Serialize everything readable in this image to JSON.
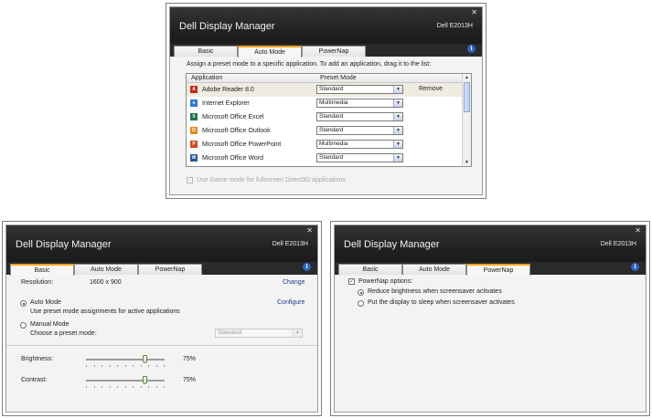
{
  "app_title": "Dell Display Manager",
  "model": "Dell E2013H",
  "close_glyph": "✕",
  "info_glyph": "i",
  "tabs": [
    "Basic",
    "Auto Mode",
    "PowerNap"
  ],
  "auto_mode": {
    "instruction": "Assign a preset mode to a specific application. To add an application, drag it to the list:",
    "col_application": "Application",
    "col_preset": "Preset Mode",
    "remove_label": "Remove",
    "rows": [
      {
        "app": "Adobe Reader 8.0",
        "mode": "Standard",
        "icon": "adobe-reader-icon",
        "color": "#c8281e",
        "glyph": "A"
      },
      {
        "app": "Internet Explorer",
        "mode": "Multimedia",
        "icon": "internet-explorer-icon",
        "color": "#2f7bd0",
        "glyph": "e"
      },
      {
        "app": "Microsoft Office Excel",
        "mode": "Standard",
        "icon": "excel-icon",
        "color": "#217346",
        "glyph": "X"
      },
      {
        "app": "Microsoft Office Outlook",
        "mode": "Standard",
        "icon": "outlook-icon",
        "color": "#e08a1e",
        "glyph": "O"
      },
      {
        "app": "Microsoft Office PowerPoint",
        "mode": "Multimedia",
        "icon": "powerpoint-icon",
        "color": "#d24726",
        "glyph": "P"
      },
      {
        "app": "Microsoft Office Word",
        "mode": "Standard",
        "icon": "word-icon",
        "color": "#2b579a",
        "glyph": "W"
      }
    ],
    "game_mode_label": "Use Game mode for fullscreen Direct3D applications",
    "game_mode_checked": true
  },
  "basic": {
    "resolution_label": "Resolution:",
    "resolution_value": "1600 x 900",
    "change_label": "Change",
    "auto_mode_label": "Auto Mode",
    "auto_mode_desc": "Use preset mode assignments for active applications",
    "configure_label": "Configure",
    "manual_mode_label": "Manual Mode",
    "manual_mode_desc": "Choose a preset mode:",
    "manual_preset_value": "Standard",
    "selected_mode": "auto",
    "brightness_label": "Brightness:",
    "brightness_value": "75%",
    "brightness_level": 0.75,
    "contrast_label": "Contrast:",
    "contrast_value": "75%",
    "contrast_level": 0.75
  },
  "powernap": {
    "options_label": "PowerNap options:",
    "options_checked": true,
    "reduce_label": "Reduce brightness when screensaver activates",
    "sleep_label": "Put the display to sleep when screensaver activates",
    "selected": "reduce"
  },
  "colors": {
    "tab_accent": "#f7a21b",
    "titlebar": "#222222",
    "link": "#1a3f8f",
    "info": "#2f63c0"
  }
}
